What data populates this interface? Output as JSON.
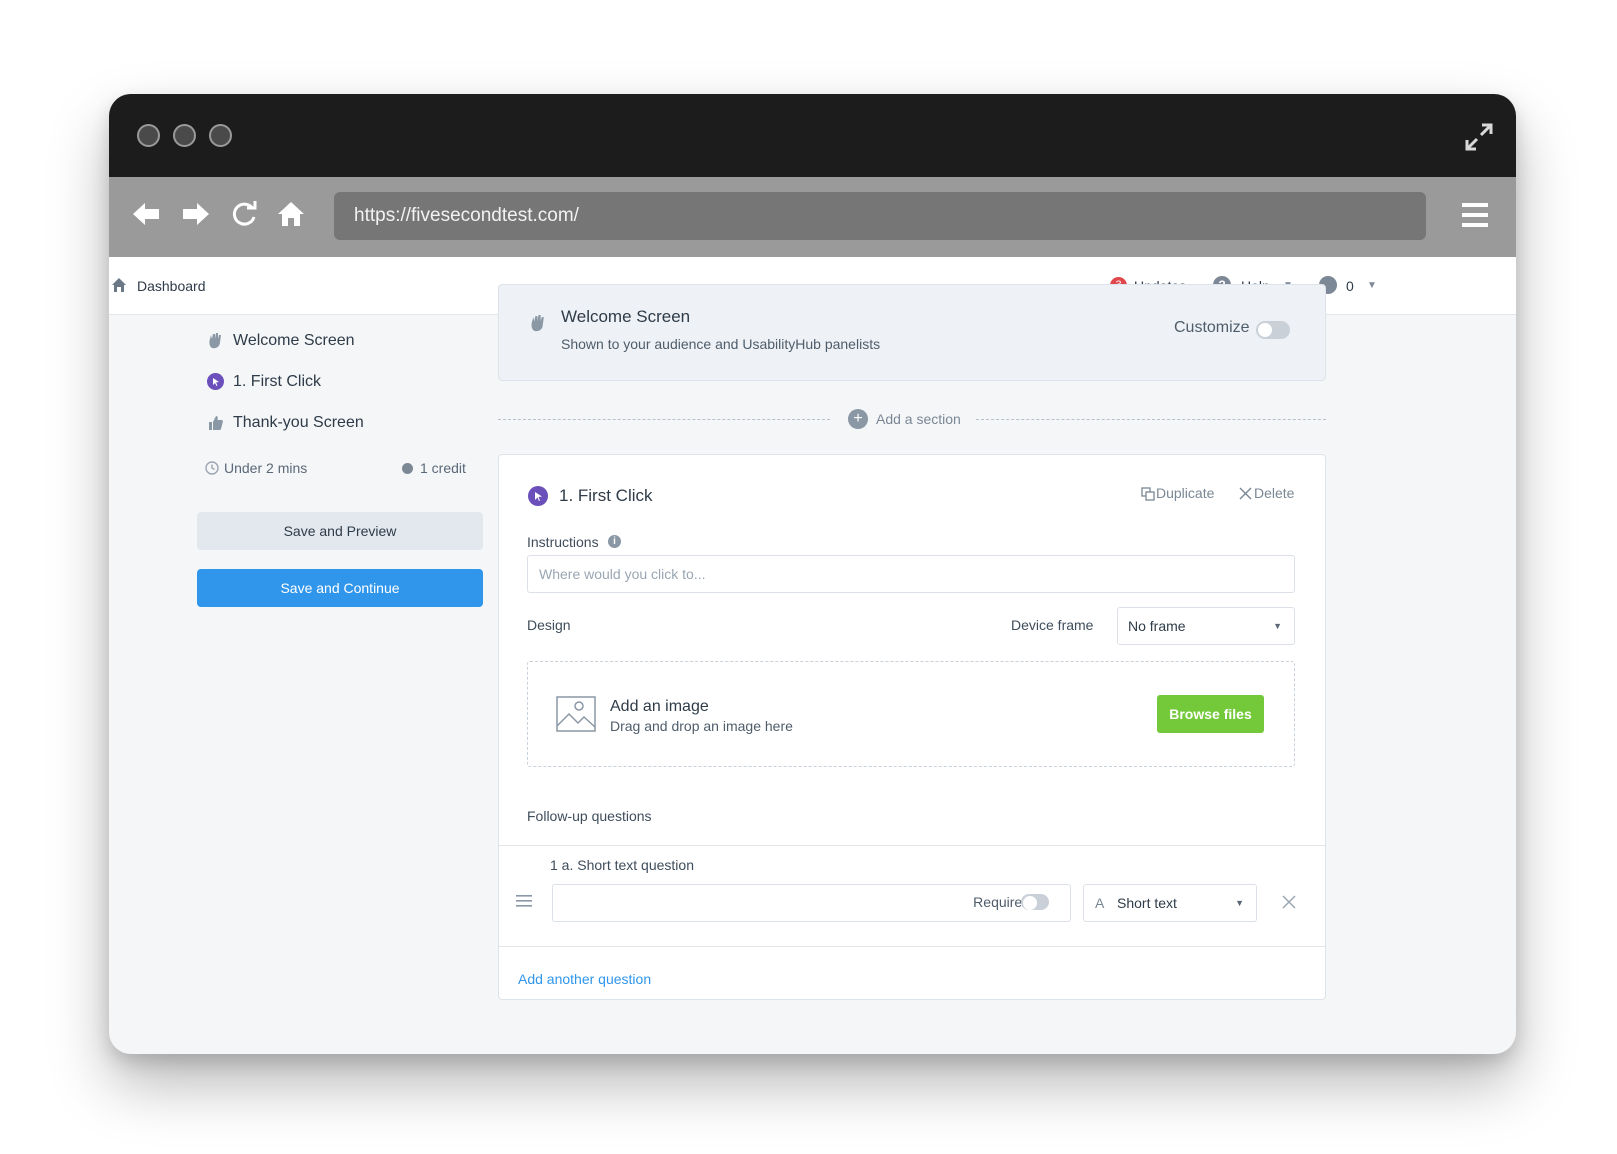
{
  "browser": {
    "url": "https://fivesecondtest.com/"
  },
  "appbar": {
    "dashboard_label": "Dashboard",
    "updates_count": "3",
    "updates_label": "Updates",
    "help_label": "Help",
    "credits_value": "0"
  },
  "sidebar": {
    "items": [
      {
        "label": "Welcome Screen"
      },
      {
        "label": "1. First Click"
      },
      {
        "label": "Thank-you Screen"
      }
    ],
    "duration": "Under 2 mins",
    "credits": "1 credit",
    "save_preview": "Save and Preview",
    "save_continue": "Save and Continue"
  },
  "welcome": {
    "title": "Welcome Screen",
    "subtitle": "Shown to your audience and UsabilityHub panelists",
    "customize": "Customize"
  },
  "add_section": "Add a section",
  "section": {
    "title": "1. First Click",
    "duplicate": "Duplicate",
    "delete": "Delete",
    "instructions_label": "Instructions",
    "instructions_placeholder": "Where would you click to...",
    "design_label": "Design",
    "device_frame_label": "Device frame",
    "device_frame_value": "No frame",
    "dropzone_title": "Add an image",
    "dropzone_sub": "Drag and drop an image here",
    "browse": "Browse files",
    "followup_label": "Follow-up questions",
    "question_label": "1 a. Short text question",
    "required_label": "Required",
    "question_type": "Short text",
    "add_question": "Add another question"
  },
  "colors": {
    "primary": "#2f96ec",
    "success": "#73c93a",
    "accent_purple": "#6b4fbb",
    "badge_red": "#e0474c"
  }
}
